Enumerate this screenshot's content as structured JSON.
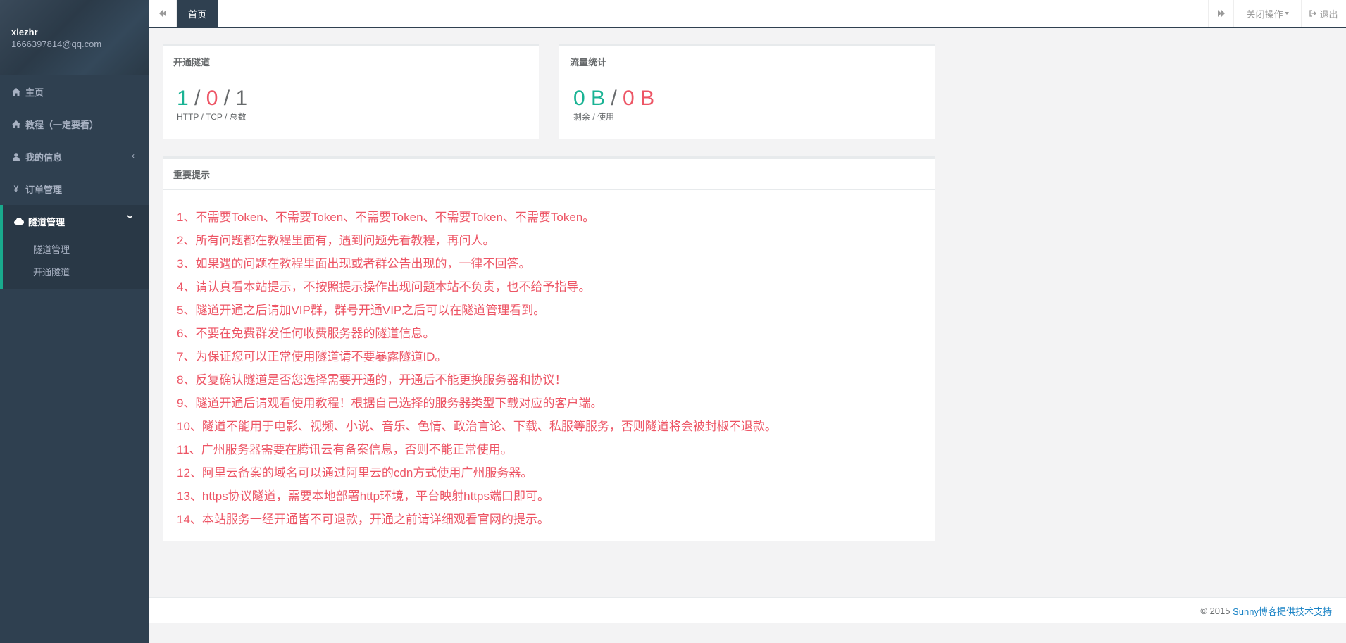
{
  "profile": {
    "username": "xiezhr",
    "email": "1666397814@qq.com"
  },
  "sidebar": {
    "items": [
      {
        "label": "主页",
        "icon": "home-icon"
      },
      {
        "label": "教程（一定要看）",
        "icon": "home-icon"
      },
      {
        "label": "我的信息",
        "icon": "user-icon"
      },
      {
        "label": "订单管理",
        "icon": "yen-icon"
      }
    ],
    "active_group": {
      "label": "隧道管理",
      "icon": "cloud-icon",
      "children": [
        "隧道管理",
        "开通隧道"
      ]
    }
  },
  "topbar": {
    "tab_home": "首页",
    "close_ops": "关闭操作",
    "logout": "退出"
  },
  "cards": {
    "tunnel": {
      "title": "开通隧道",
      "http": "1",
      "tcp": "0",
      "total": "1",
      "caption": "HTTP / TCP / 总数"
    },
    "traffic": {
      "title": "流量统计",
      "remaining": "0 B",
      "used": "0 B",
      "caption": "剩余 / 使用"
    },
    "notice": {
      "title": "重要提示",
      "items": [
        "1、不需要Token、不需要Token、不需要Token、不需要Token、不需要Token。",
        "2、所有问题都在教程里面有，遇到问题先看教程，再问人。",
        "3、如果遇的问题在教程里面出现或者群公告出现的，一律不回答。",
        "4、请认真看本站提示，不按照提示操作出现问题本站不负责，也不给予指导。",
        "5、隧道开通之后请加VIP群，群号开通VIP之后可以在隧道管理看到。",
        "6、不要在免费群发任何收费服务器的隧道信息。",
        "7、为保证您可以正常使用隧道请不要暴露隧道ID。",
        "8、反复确认隧道是否您选择需要开通的，开通后不能更换服务器和协议！",
        "9、隧道开通后请观看使用教程！根据自己选择的服务器类型下载对应的客户端。",
        "10、隧道不能用于电影、视频、小说、音乐、色情、政治言论、下载、私服等服务，否则隧道将会被封椒不退款。",
        "11、广州服务器需要在腾讯云有备案信息，否则不能正常使用。",
        "12、阿里云备案的域名可以通过阿里云的cdn方式使用广州服务器。",
        "13、https协议隧道，需要本地部署http环境，平台映射https端口即可。",
        "14、本站服务一经开通皆不可退款，开通之前请详细观看官网的提示。"
      ]
    }
  },
  "footer": {
    "copyright": "© 2015 ",
    "link": "Sunny博客提供技术支持"
  },
  "colors": {
    "sidebar": "#2f4050",
    "green": "#1ab394",
    "red": "#ed5565",
    "link": "#1c84c6"
  }
}
